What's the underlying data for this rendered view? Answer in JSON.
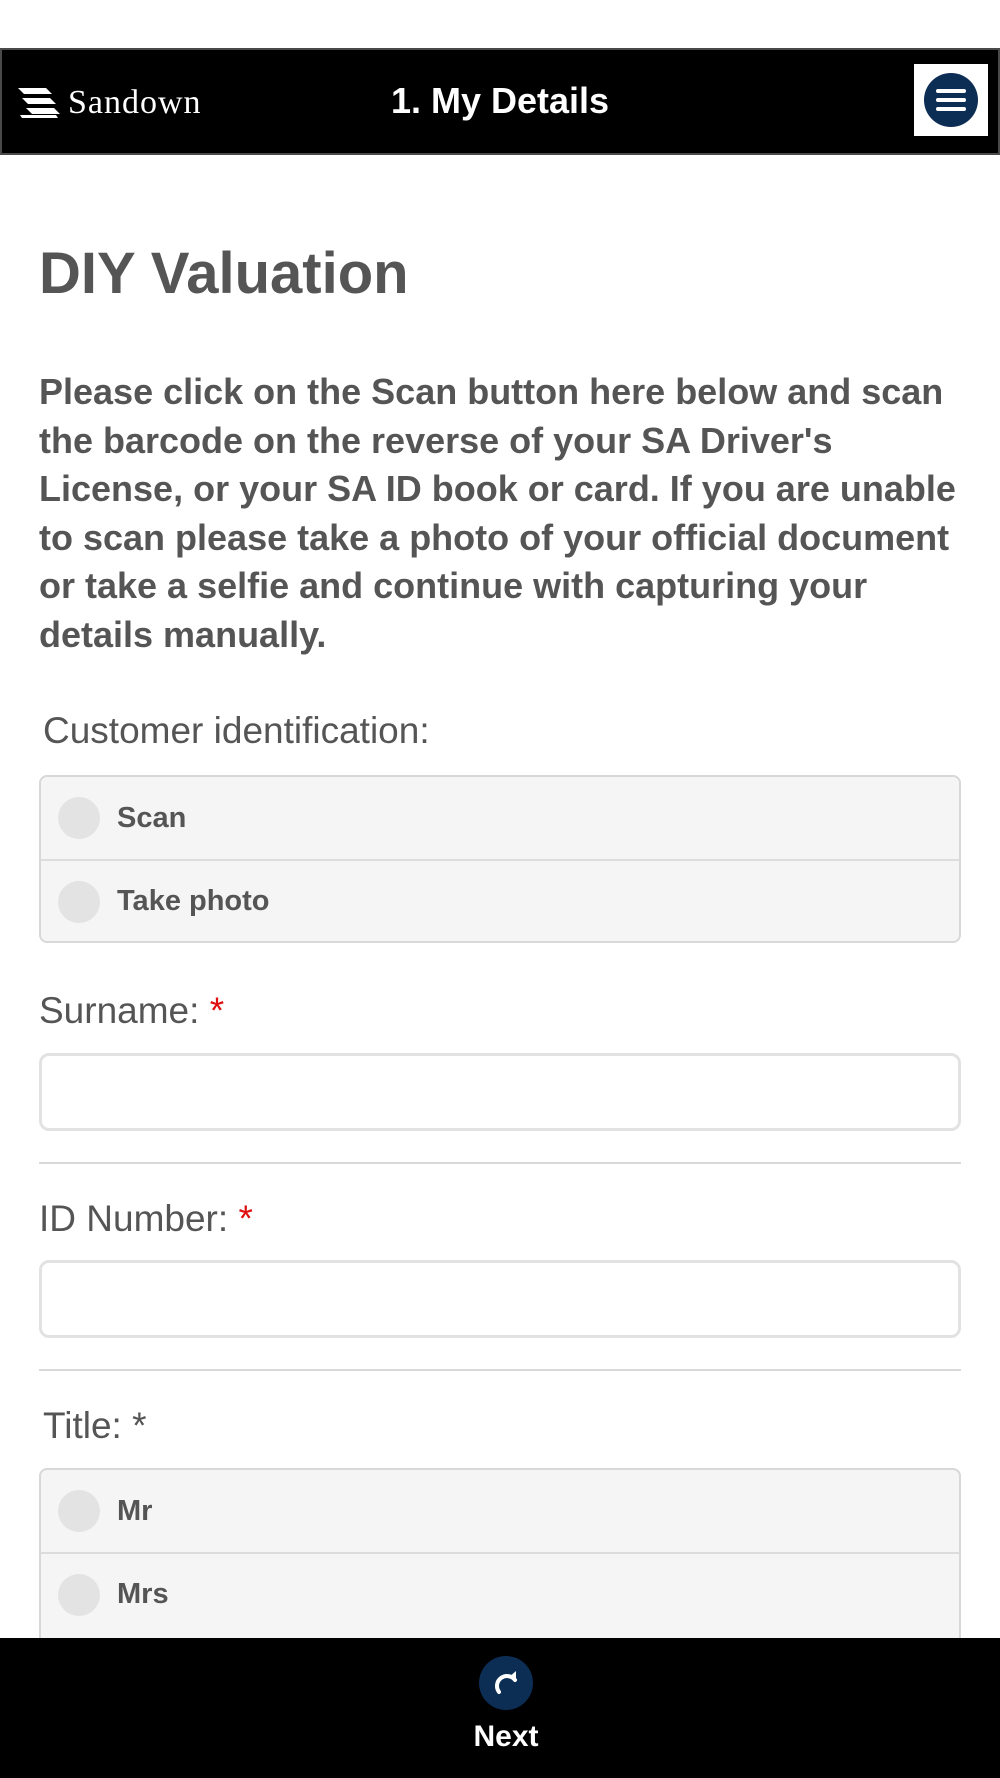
{
  "header": {
    "logo_text": "Sandown",
    "title": "1. My Details",
    "menu_icon": "menu-icon"
  },
  "main": {
    "title": "DIY Valuation",
    "intro": "Please click on the Scan button here below and scan the barcode on the reverse of your SA Driver's License, or your SA ID book or card. If you are unable to scan please take a photo of your official document or take a selfie and continue with capturing your details manually."
  },
  "customer_identification": {
    "label": "Customer identification:",
    "options": [
      {
        "label": "Scan",
        "selected": false
      },
      {
        "label": "Take photo",
        "selected": false
      }
    ]
  },
  "surname": {
    "label": "Surname:",
    "required_mark": "*",
    "value": "",
    "placeholder": ""
  },
  "id_number": {
    "label": "ID Number:",
    "required_mark": "*",
    "value": "",
    "placeholder": ""
  },
  "title_field": {
    "label": "Title: *",
    "options": [
      {
        "label": "Mr",
        "selected": false
      },
      {
        "label": "Mrs",
        "selected": false
      }
    ]
  },
  "footer": {
    "next_label": "Next",
    "next_icon": "redo-arrow-icon"
  },
  "colors": {
    "header_bg": "#000000",
    "accent": "#0c2d54",
    "required": "#e01010",
    "text": "#555555"
  }
}
